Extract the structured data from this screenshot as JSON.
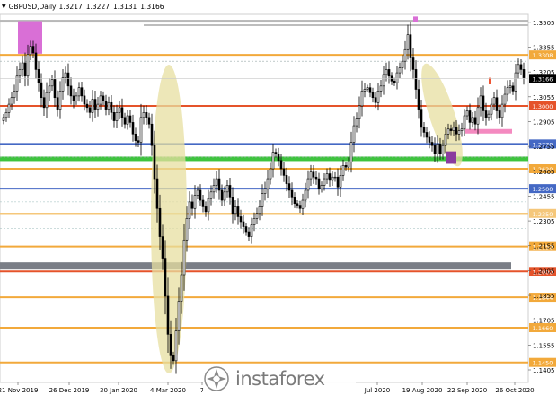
{
  "header": {
    "symbol": "GBPUSD,Daily",
    "open": "1.3217",
    "high": "1.3227",
    "low": "1.3131",
    "close": "1.3166",
    "caret_icon": "triangle-down-icon"
  },
  "watermark": {
    "text": "instaforex",
    "logo_icon": "instaforex-logo-icon"
  },
  "chart_data": {
    "type": "candlestick",
    "symbol": "GBPUSD",
    "timeframe": "Daily",
    "ylim": [
      1.14,
      1.355
    ],
    "y_ticks": [
      "1.3505",
      "1.3355",
      "1.3205",
      "1.3055",
      "1.2905",
      "1.2755",
      "1.2605",
      "1.2455",
      "1.2305",
      "1.2155",
      "1.2005",
      "1.1855",
      "1.1705",
      "1.1555",
      "1.1405"
    ],
    "x_ticks": [
      "21 Nov 2019",
      "26 Dec 2019",
      "30 Jan 2020",
      "4 Mar 2020",
      "7",
      "Jul 2020",
      "19 Aug 2020",
      "22 Sep 2020",
      "26 Oct 2020"
    ],
    "current_price": "1.3166",
    "levels": [
      {
        "value": 1.3512,
        "label": "",
        "color": "#b8b8b8",
        "style": "band"
      },
      {
        "value": 1.3308,
        "label": "1.3308",
        "color": "#f2a93b",
        "style": "line"
      },
      {
        "value": 1.3,
        "label": "1.3000",
        "color": "#e5532a",
        "style": "line"
      },
      {
        "value": 1.277,
        "label": "1.2770",
        "color": "#4468c4",
        "style": "line"
      },
      {
        "value": 1.268,
        "label": "",
        "color": "#3ec43e",
        "style": "band"
      },
      {
        "value": 1.262,
        "label": "1.2620",
        "color": "#f2a93b",
        "style": "line"
      },
      {
        "value": 1.25,
        "label": "1.2500",
        "color": "#4468c4",
        "style": "line"
      },
      {
        "value": 1.235,
        "label": "1.2350",
        "color": "#f5c77a",
        "style": "line"
      },
      {
        "value": 1.215,
        "label": "1.2150",
        "color": "#f2a93b",
        "style": "line"
      },
      {
        "value": 1.2,
        "label": "1.2000",
        "color": "#e5532a",
        "style": "line"
      },
      {
        "value": 1.1844,
        "label": "1.1844",
        "color": "#f2a93b",
        "style": "line"
      },
      {
        "value": 1.166,
        "label": "1.1660",
        "color": "#f2a93b",
        "style": "line"
      },
      {
        "value": 1.145,
        "label": "1.1450",
        "color": "#f2a93b",
        "style": "line"
      }
    ],
    "series_close": [
      1.293,
      1.296,
      1.301,
      1.305,
      1.309,
      1.318,
      1.322,
      1.326,
      1.318,
      1.331,
      1.336,
      1.332,
      1.322,
      1.314,
      1.305,
      1.299,
      1.308,
      1.312,
      1.316,
      1.305,
      1.298,
      1.309,
      1.317,
      1.32,
      1.312,
      1.306,
      1.303,
      1.306,
      1.311,
      1.306,
      1.301,
      1.299,
      1.296,
      1.304,
      1.298,
      1.301,
      1.306,
      1.303,
      1.298,
      1.302,
      1.296,
      1.291,
      1.296,
      1.299,
      1.293,
      1.289,
      1.294,
      1.29,
      1.283,
      1.279,
      1.278,
      1.293,
      1.296,
      1.293,
      1.289,
      1.276,
      1.256,
      1.238,
      1.221,
      1.208,
      1.185,
      1.162,
      1.149,
      1.146,
      1.164,
      1.182,
      1.198,
      1.219,
      1.232,
      1.242,
      1.238,
      1.246,
      1.249,
      1.243,
      1.239,
      1.236,
      1.244,
      1.248,
      1.252,
      1.256,
      1.249,
      1.243,
      1.248,
      1.252,
      1.245,
      1.235,
      1.239,
      1.233,
      1.23,
      1.227,
      1.224,
      1.221,
      1.228,
      1.232,
      1.235,
      1.239,
      1.247,
      1.25,
      1.256,
      1.262,
      1.272,
      1.271,
      1.267,
      1.262,
      1.258,
      1.253,
      1.249,
      1.245,
      1.241,
      1.24,
      1.238,
      1.243,
      1.249,
      1.256,
      1.26,
      1.257,
      1.256,
      1.25,
      1.252,
      1.256,
      1.259,
      1.255,
      1.257,
      1.257,
      1.251,
      1.258,
      1.264,
      1.263,
      1.266,
      1.278,
      1.288,
      1.292,
      1.3,
      1.309,
      1.31,
      1.311,
      1.308,
      1.305,
      1.302,
      1.309,
      1.312,
      1.319,
      1.322,
      1.318,
      1.315,
      1.314,
      1.32,
      1.323,
      1.327,
      1.334,
      1.343,
      1.329,
      1.322,
      1.31,
      1.298,
      1.287,
      1.284,
      1.281,
      1.278,
      1.276,
      1.271,
      1.277,
      1.271,
      1.276,
      1.283,
      1.286,
      1.285,
      1.287,
      1.283,
      1.285,
      1.286,
      1.294,
      1.297,
      1.29,
      1.293,
      1.289,
      1.299,
      1.306,
      1.297,
      1.293,
      1.295,
      1.301,
      1.305,
      1.297,
      1.293,
      1.301,
      1.307,
      1.311,
      1.312,
      1.309,
      1.32,
      1.325,
      1.322,
      1.317
    ]
  }
}
